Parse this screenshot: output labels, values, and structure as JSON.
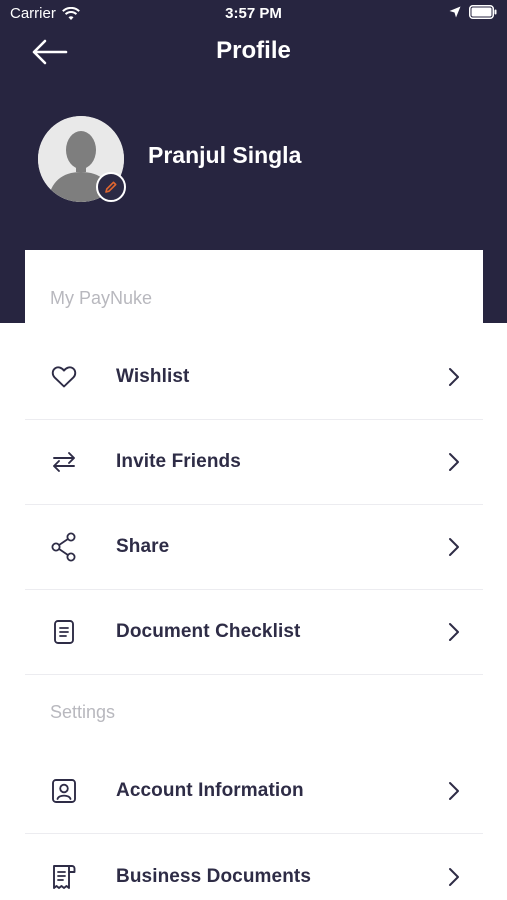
{
  "status_bar": {
    "carrier": "Carrier",
    "time": "3:57 PM"
  },
  "nav": {
    "title": "Profile"
  },
  "profile": {
    "name": "Pranjul Singla"
  },
  "sections": {
    "my_paynuke": {
      "title": "My PayNuke",
      "items": [
        {
          "label": "Wishlist",
          "icon": "heart-icon"
        },
        {
          "label": "Invite Friends",
          "icon": "swap-arrows-icon"
        },
        {
          "label": "Share",
          "icon": "share-icon"
        },
        {
          "label": "Document Checklist",
          "icon": "document-icon"
        }
      ]
    },
    "settings": {
      "title": "Settings",
      "items": [
        {
          "label": "Account Information",
          "icon": "account-icon"
        },
        {
          "label": "Business Documents",
          "icon": "receipt-icon"
        }
      ]
    }
  },
  "colors": {
    "header_bg": "#272540",
    "text_dark": "#2e2c46",
    "section_gray": "#b8b8be",
    "edit_accent": "#e0662f"
  }
}
